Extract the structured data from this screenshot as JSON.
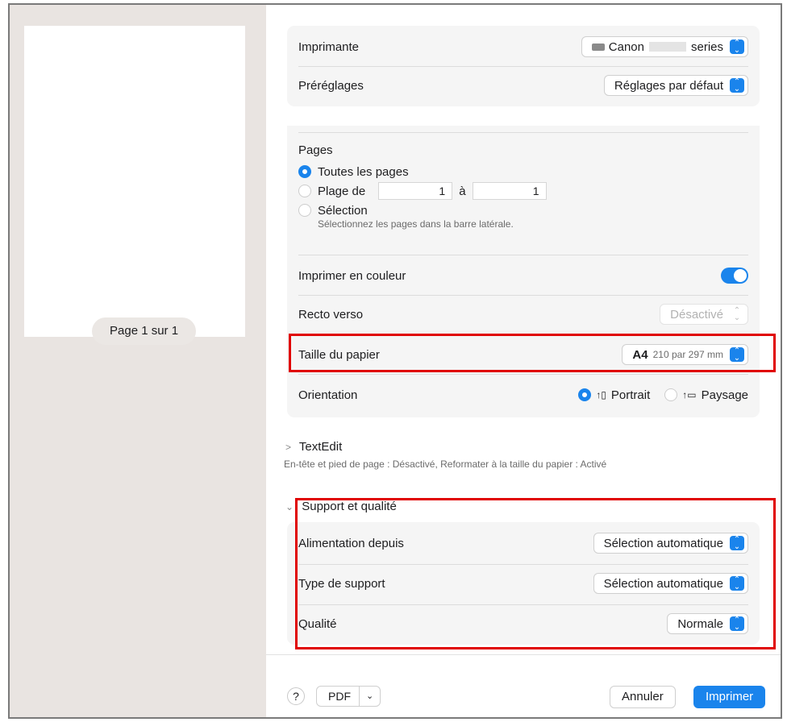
{
  "preview": {
    "page_label": "Page 1 sur 1"
  },
  "printer": {
    "label": "Imprimante",
    "value": "Canon",
    "value_suffix": "series"
  },
  "presets": {
    "label": "Préréglages",
    "value": "Réglages par défaut"
  },
  "pages": {
    "title": "Pages",
    "all_pages": "Toutes les pages",
    "range_label": "Plage de",
    "range_from": "1",
    "range_to_label": "à",
    "range_to": "1",
    "selection_label": "Sélection",
    "selection_hint": "Sélectionnez les pages dans la barre latérale."
  },
  "color": {
    "label": "Imprimer en couleur",
    "enabled": true
  },
  "duplex": {
    "label": "Recto verso",
    "value": "Désactivé"
  },
  "paper_size": {
    "label": "Taille du papier",
    "value": "A4",
    "detail": "210 par 297 mm"
  },
  "orientation": {
    "label": "Orientation",
    "portrait": "Portrait",
    "landscape": "Paysage",
    "selected": "Portrait"
  },
  "textedit": {
    "title": "TextEdit",
    "summary": "En-tête et pied de page : Désactivé, Reformater à la taille du papier : Activé"
  },
  "media_quality": {
    "title": "Support et qualité",
    "paper_source_label": "Alimentation depuis",
    "paper_source_value": "Sélection automatique",
    "media_type_label": "Type de support",
    "media_type_value": "Sélection automatique",
    "quality_label": "Qualité",
    "quality_value": "Normale"
  },
  "footer": {
    "help": "?",
    "pdf": "PDF",
    "cancel": "Annuler",
    "print": "Imprimer"
  },
  "colors": {
    "accent": "#1a84ec",
    "highlight": "#e00000",
    "sidebar_bg": "#e9e4e1"
  }
}
